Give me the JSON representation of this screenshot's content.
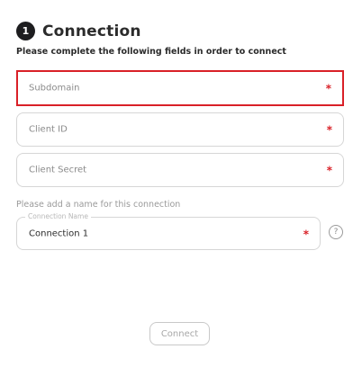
{
  "step": {
    "number": "1",
    "title": "Connection"
  },
  "instructions": "Please complete the following fields in order to connect",
  "fields": {
    "subdomain": {
      "placeholder": "Subdomain",
      "required_mark": "*"
    },
    "client_id": {
      "placeholder": "Client ID",
      "required_mark": "*"
    },
    "client_secret": {
      "placeholder": "Client Secret",
      "required_mark": "*"
    }
  },
  "name_section": {
    "instructions": "Please add a name for this connection",
    "legend": "Connection Name",
    "value": "Connection 1",
    "required_mark": "*",
    "help_glyph": "?"
  },
  "actions": {
    "connect_label": "Connect"
  },
  "colors": {
    "accent_error": "#d92027",
    "badge_bg": "#1d1d1f",
    "border": "#d6d6d6"
  }
}
